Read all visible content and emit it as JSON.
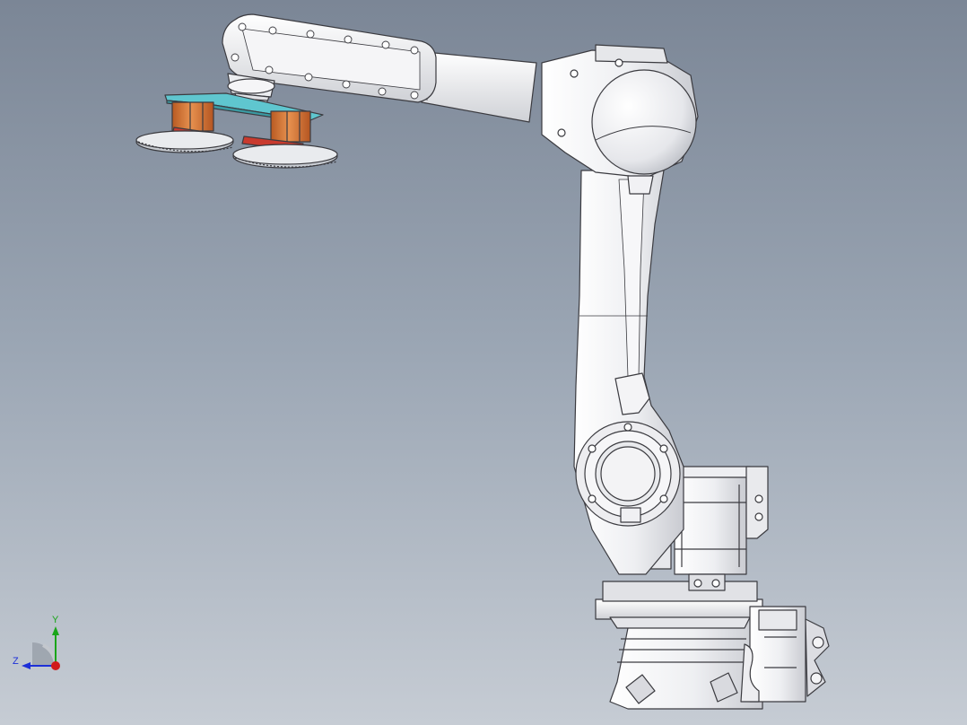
{
  "viewport": {
    "background_top": "#7b8696",
    "background_bottom": "#c6ccd4"
  },
  "model": {
    "icon": "industrial-robot-arm-model",
    "part_colors": {
      "body": "#f2f2f4",
      "edges": "#3b3b40",
      "tool_plate": "#5fc6cf",
      "actuators": "#d8763a",
      "pads": "#c93a2e",
      "cups": "#c8ccd2"
    }
  },
  "triad": {
    "icon": "view-orientation-triad",
    "y_label": "Y",
    "z_label": "Z",
    "y_color": "#1aa51a",
    "z_color": "#1d2fd8",
    "x_color": "#d11a1a"
  }
}
